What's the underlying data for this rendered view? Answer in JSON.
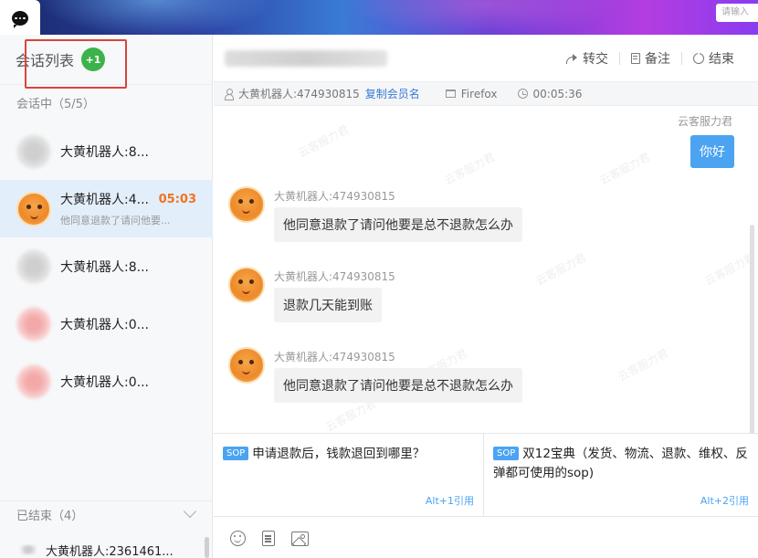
{
  "banner": {
    "search_placeholder": "请输入"
  },
  "left": {
    "title": "会话列表",
    "badge": "+1",
    "active_section": "会话中（5/5）",
    "conversations": [
      {
        "name": "大黄机器人:8...",
        "preview": "",
        "time": "",
        "avatar": "blurred-gray"
      },
      {
        "name": "大黄机器人:4...",
        "preview": "他同意退款了请问他要...",
        "time": "05:03",
        "avatar": "robot-orange"
      },
      {
        "name": "大黄机器人:8...",
        "preview": "",
        "time": "",
        "avatar": "blurred-gray"
      },
      {
        "name": "大黄机器人:0...",
        "preview": "",
        "time": "",
        "avatar": "blurred-pink"
      },
      {
        "name": "大黄机器人:0...",
        "preview": "",
        "time": "",
        "avatar": "blurred-pink"
      }
    ],
    "ended_section": "已结束（4）",
    "ended_items": [
      {
        "name": "大黄机器人:2361461..."
      }
    ]
  },
  "header": {
    "actions": {
      "transfer": "转交",
      "note": "备注",
      "end": "结束"
    }
  },
  "info_bar": {
    "member": "大黄机器人:474930815",
    "copy_link": "复制会员名",
    "browser": "Firefox",
    "duration": "00:05:36"
  },
  "chat": {
    "watermark": "云客服力君",
    "agent_name": "云客服力君",
    "agent_message": "你好",
    "messages": [
      {
        "sender": "大黄机器人:474930815",
        "text": "他同意退款了请问他要是总不退款怎么办"
      },
      {
        "sender": "大黄机器人:474930815",
        "text": "退款几天能到账"
      },
      {
        "sender": "大黄机器人:474930815",
        "text": "他同意退款了请问他要是总不退款怎么办"
      }
    ]
  },
  "sop": {
    "tag": "SOP",
    "cards": [
      {
        "text": "申请退款后，钱款退回到哪里？",
        "hint": "Alt+1引用"
      },
      {
        "text": "双12宝典（发货、物流、退款、维权、反弹都可使用的sop)",
        "hint": "Alt+2引用"
      }
    ]
  },
  "colors": {
    "accent": "#4ba3f2",
    "badge_green": "#3bb34a",
    "timer_orange": "#f0731f",
    "highlight_red": "#d9453b"
  }
}
